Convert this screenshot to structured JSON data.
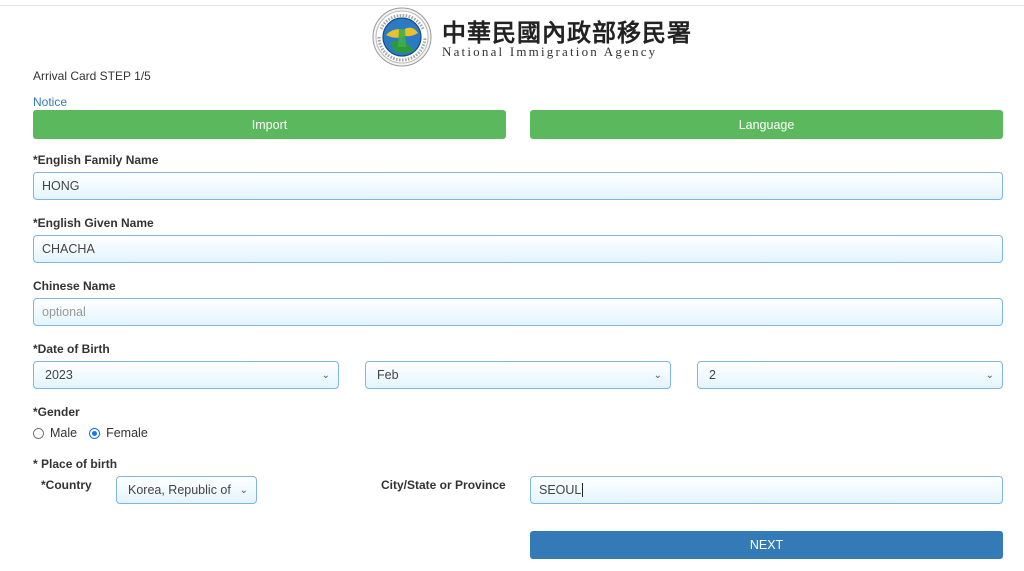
{
  "header": {
    "agency_name_cn": "中華民國內政部移民署",
    "agency_name_en": "National Immigration Agency",
    "seal_text": "National Immigration Agency"
  },
  "form": {
    "step_title": "Arrival Card STEP 1/5",
    "notice_link": "Notice",
    "import_button": "Import",
    "language_button": "Language",
    "family_name": {
      "label": "*English Family Name",
      "value": "HONG"
    },
    "given_name": {
      "label": "*English Given Name",
      "value": "CHACHA"
    },
    "chinese_name": {
      "label": "Chinese Name",
      "value": "",
      "placeholder": "optional"
    },
    "dob": {
      "label": "*Date of Birth",
      "year": "2023",
      "month": "Feb",
      "day": "2"
    },
    "gender": {
      "label": "*Gender",
      "options": [
        "Male",
        "Female"
      ],
      "selected": "Female"
    },
    "place_of_birth": {
      "label": "* Place of birth",
      "country_label": "*Country",
      "country_value": "Korea, Republic of",
      "city_label": "City/State or Province",
      "city_value": "SEOUL"
    },
    "next_button": "NEXT"
  },
  "colors": {
    "green_button": "#5cb85c",
    "next_button": "#337ab7",
    "link": "#337ab7",
    "radio_selected": "#1a73e8",
    "field_border": "#7fb5e0"
  },
  "icons": {
    "seal": "immigration-agency-seal-icon",
    "select_arrow": "chevron-down-icon"
  }
}
